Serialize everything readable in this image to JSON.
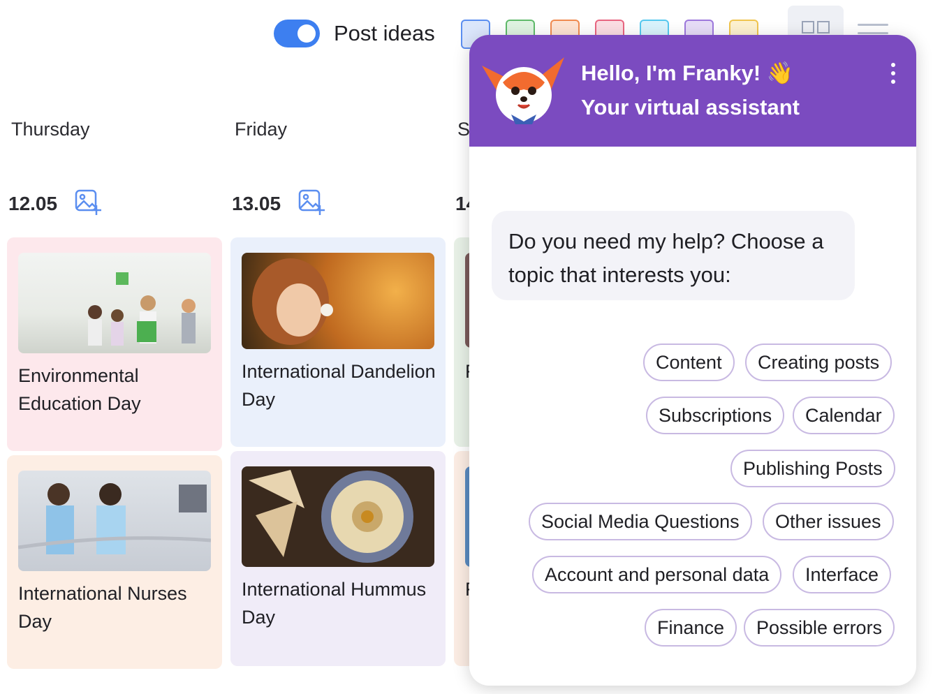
{
  "toolbar": {
    "post_ideas_label": "Post ideas",
    "post_ideas_enabled": true,
    "color_filters": [
      {
        "fill": "#dbe6fb",
        "border": "#5b8ef0"
      },
      {
        "fill": "#dff3e1",
        "border": "#5fba6a"
      },
      {
        "fill": "#fde3d3",
        "border": "#f08a4f"
      },
      {
        "fill": "#fbdde3",
        "border": "#e86580"
      },
      {
        "fill": "#d9f3fc",
        "border": "#56c8ef"
      },
      {
        "fill": "#e6dcf7",
        "border": "#9d78dc"
      },
      {
        "fill": "#fdf1cf",
        "border": "#f0c54e"
      }
    ]
  },
  "calendar": {
    "days": [
      {
        "name": "Thursday",
        "date": "12.05"
      },
      {
        "name": "Friday",
        "date": "13.05"
      },
      {
        "name": "S",
        "date": "14"
      }
    ],
    "cards": [
      {
        "title": "Environmental Education Day",
        "bg": "#fde8ec"
      },
      {
        "title": "International Dandelion Day",
        "bg": "#eaf0fb"
      },
      {
        "title": "International Nurses Day",
        "bg": "#fdeee4"
      },
      {
        "title": "International Hummus Day",
        "bg": "#f0ecf8"
      }
    ],
    "partial_cards": [
      {
        "title": "F",
        "bg": "#e7f0e6"
      },
      {
        "title": "F",
        "bg": "#fbece3"
      }
    ]
  },
  "chat": {
    "title": "Hello, I'm Franky! 👋",
    "subtitle": "Your virtual assistant",
    "message": "Do you need my help? Choose a topic that interests you:",
    "topics": [
      "Content",
      "Creating posts",
      "Subscriptions",
      "Calendar",
      "Publishing Posts",
      "Social Media Questions",
      "Other issues",
      "Account and personal data",
      "Interface",
      "Finance",
      "Possible errors"
    ]
  },
  "colors": {
    "accent": "#3d7ff0",
    "chat_header": "#7b4bc0",
    "chip_border": "#c8b9e2"
  }
}
